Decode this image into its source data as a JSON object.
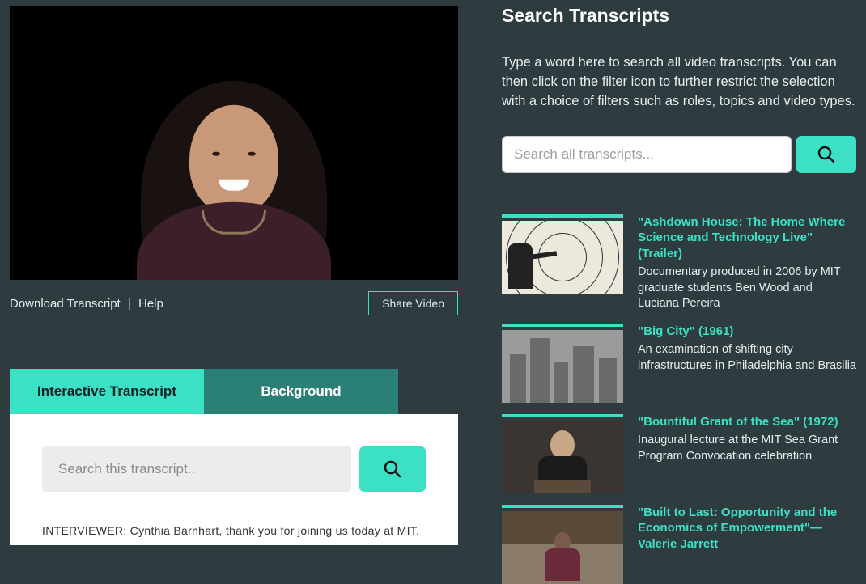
{
  "under_video": {
    "download": "Download Transcript",
    "help": "Help",
    "share": "Share Video"
  },
  "tabs": {
    "transcript": "Interactive Transcript",
    "background": "Background"
  },
  "panel": {
    "search_placeholder": "Search this transcript..",
    "body_preview": "INTERVIEWER: Cynthia Barnhart, thank you for joining us today at MIT."
  },
  "right": {
    "title": "Search Transcripts",
    "desc": "Type a word here to search all video transcripts. You can then click on the filter icon to further restrict the selection with a choice of filters such as roles, topics and video types.",
    "search_placeholder": "Search all transcripts..."
  },
  "results": [
    {
      "title": "\"Ashdown House: The Home Where Science and Technology Live\" (Trailer)",
      "desc": "Documentary produced in 2006 by MIT graduate students Ben Wood and Luciana Pereira"
    },
    {
      "title": "\"Big City\" (1961)",
      "desc": "An examination of shifting city infrastructures in Philadelphia and Brasilia"
    },
    {
      "title": "\"Bountiful Grant of the Sea\" (1972)",
      "desc": "Inaugural lecture at the MIT Sea Grant Program Convocation celebration"
    },
    {
      "title": "\"Built to Last: Opportunity and the Economics of Empowerment\"—Valerie Jarrett",
      "desc": ""
    }
  ]
}
